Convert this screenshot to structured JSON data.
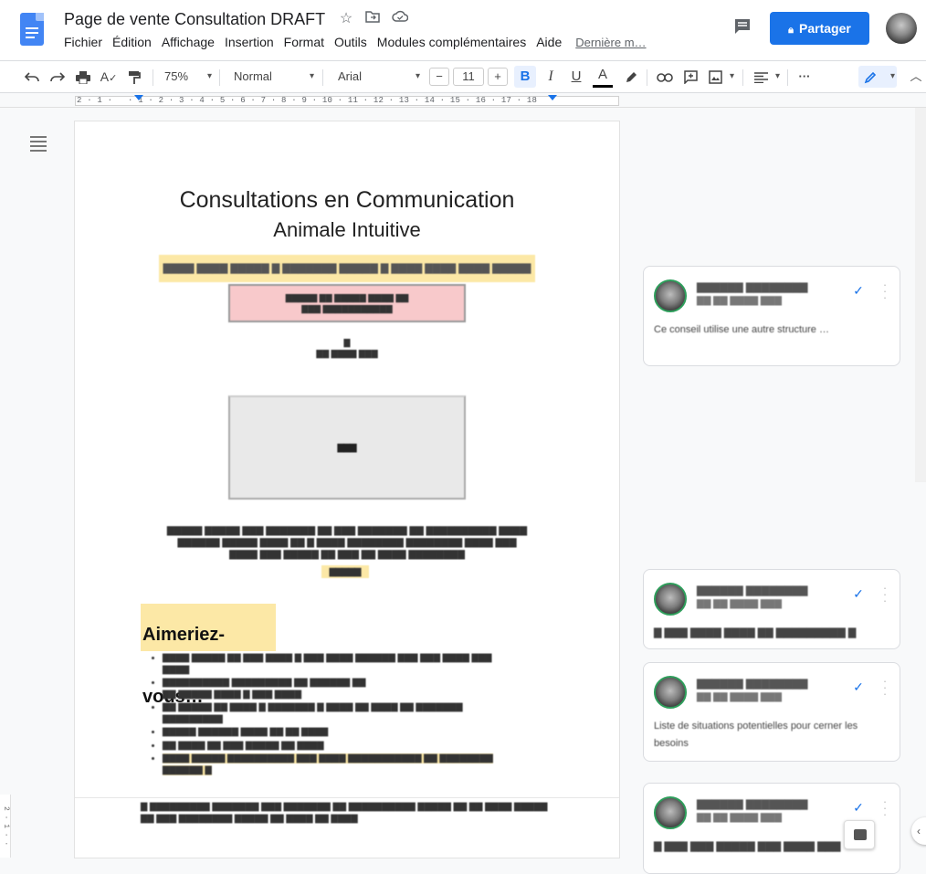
{
  "app": {
    "title": "Page de vente Consultation DRAFT",
    "menus": [
      "Fichier",
      "Édition",
      "Affichage",
      "Insertion",
      "Format",
      "Outils",
      "Modules complémentaires",
      "Aide"
    ],
    "last_edit": "Dernière m…",
    "share_label": "Partager",
    "accent": "#1a73e8"
  },
  "toolbar": {
    "zoom": "75%",
    "style": "Normal",
    "font": "Arial",
    "font_size": "11",
    "decrease": "−",
    "increase": "+",
    "bold": "B",
    "italic": "I",
    "underline": "U",
    "text_color": "A",
    "more": "···"
  },
  "ruler": {
    "labels": "2 · 1 ·   · 1 · 2 · 3 · 4 · 5 · 6 · 7 · 8 · 9 · 10 · 11 · 12 · 13 · 14 · 15 · 16 · 17 · 18"
  },
  "document": {
    "title_line1": "Consultations en Communication",
    "title_line2": "Animale Intuitive",
    "section_heading": "Aimeriez-vous…"
  },
  "comments": [
    {
      "text": "Ce conseil utilise une autre structure …"
    },
    {
      "text": ""
    },
    {
      "text": "Liste de situations potentielles pour cerner les besoins"
    },
    {
      "text": ""
    }
  ],
  "vertical_ruler": "2 · 1 · ·"
}
